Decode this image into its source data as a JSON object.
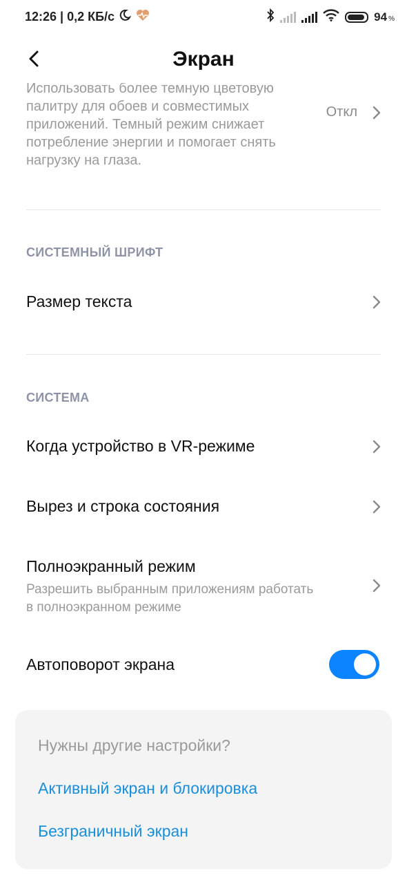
{
  "status_bar": {
    "time_speed": "12:26 | 0,2 КБ/с",
    "battery_level": "94",
    "battery_pct_symbol": "%"
  },
  "header": {
    "title": "Экран",
    "back_icon": "chevron-left-icon"
  },
  "dark_mode": {
    "description": "Использовать более темную цветовую палитру для обоев и совместимых приложений. Темный режим снижает потребление энергии и помогает снять нагрузку на глаза.",
    "value": "Откл"
  },
  "sections": {
    "system_font": {
      "header": "СИСТЕМНЫЙ ШРИФТ",
      "text_size_label": "Размер текста"
    },
    "system": {
      "header": "СИСТЕМА",
      "vr_label": "Когда устройство в VR-режиме",
      "notch_label": "Вырез и строка состояния",
      "fullscreen_label": "Полноэкранный режим",
      "fullscreen_sub": "Разрешить выбранным приложениям работать в полноэкранном режиме",
      "autorotate_label": "Автоповорот экрана",
      "autorotate_on": true
    }
  },
  "more_settings": {
    "title": "Нужны другие настройки?",
    "link_1": "Активный экран и блокировка",
    "link_2": "Безграничный экран"
  },
  "colors": {
    "accent": "#0d84ff",
    "link": "#1a8fd9",
    "section_header": "#8e94a6"
  }
}
